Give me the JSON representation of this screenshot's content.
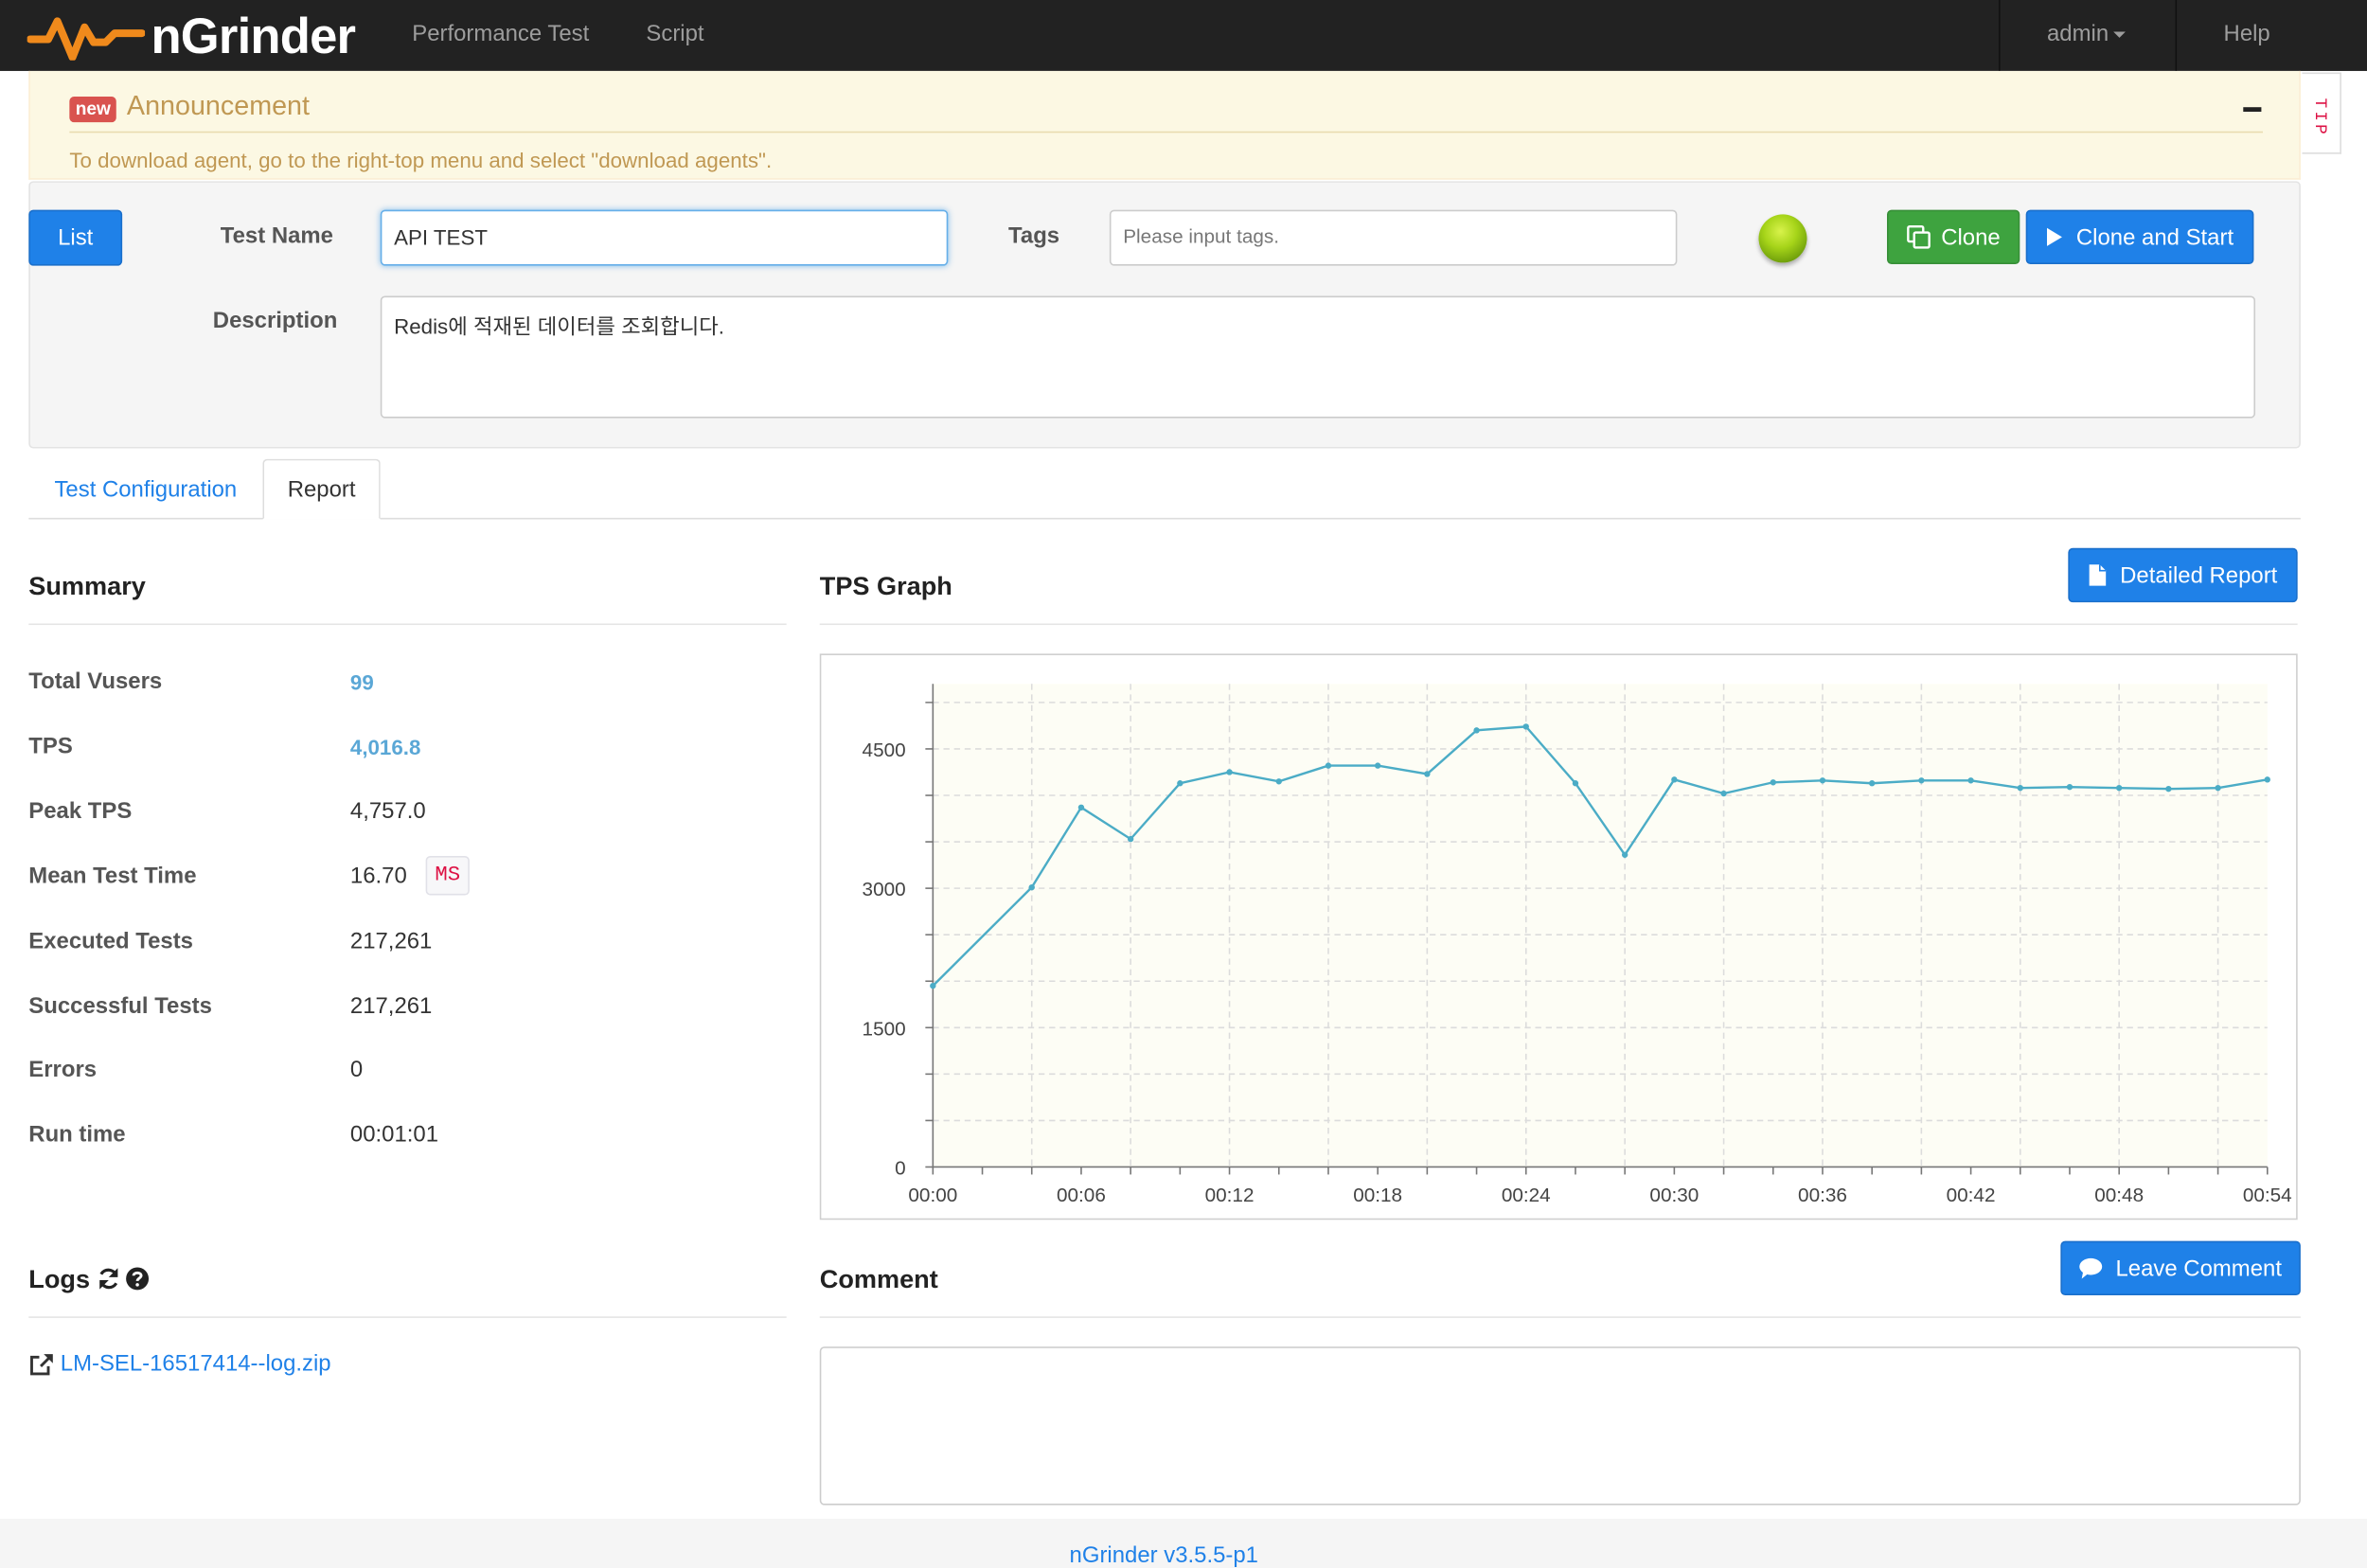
{
  "navbar": {
    "brand": "nGrinder",
    "links": [
      "Performance Test",
      "Script"
    ],
    "user": "admin",
    "help": "Help"
  },
  "announcement": {
    "badge": "new",
    "title": "Announcement",
    "body": "To download agent, go to the right-top menu and select \"download agents\"."
  },
  "tip": "TIP",
  "form": {
    "list_label": "List",
    "test_name_label": "Test Name",
    "test_name_value": "API TEST",
    "tags_label": "Tags",
    "tags_placeholder": "Please input tags.",
    "description_label": "Description",
    "description_value": "Redis에 적재된 데이터를 조회합니다.",
    "clone_label": "Clone",
    "clone_start_label": "Clone and Start",
    "status_color": "#a6d419"
  },
  "tabs": [
    {
      "label": "Test Configuration",
      "active": false
    },
    {
      "label": "Report",
      "active": true
    }
  ],
  "summary": {
    "title": "Summary",
    "rows": [
      {
        "key": "Total Vusers",
        "value": "99"
      },
      {
        "key": "TPS",
        "value": "4,016.8"
      },
      {
        "key": "Peak TPS",
        "value": "4,757.0"
      },
      {
        "key": "Mean Test Time",
        "value": "16.70"
      },
      {
        "key": "Executed Tests",
        "value": "217,261"
      },
      {
        "key": "Successful Tests",
        "value": "217,261"
      },
      {
        "key": "Errors",
        "value": "0"
      },
      {
        "key": "Run time",
        "value": "00:01:01"
      }
    ],
    "mean_unit": "MS"
  },
  "tps_graph": {
    "title": "TPS Graph",
    "detailed_report_label": "Detailed Report"
  },
  "chart_data": {
    "type": "line",
    "title": "",
    "xlabel": "",
    "ylabel": "",
    "x_ticks": [
      "00:00",
      "00:06",
      "00:12",
      "00:18",
      "00:24",
      "00:30",
      "00:36",
      "00:42",
      "00:48",
      "00:54"
    ],
    "y_ticks": [
      0,
      1500,
      3000,
      4500
    ],
    "ylim": [
      0,
      5200
    ],
    "x_seconds": [
      0,
      4,
      6,
      8,
      10,
      12,
      14,
      16,
      18,
      20,
      22,
      24,
      26,
      28,
      30,
      32,
      34,
      36,
      38,
      40,
      42,
      44,
      46,
      48,
      50,
      52,
      54
    ],
    "values": [
      1950,
      3010,
      3870,
      3530,
      4130,
      4250,
      4150,
      4320,
      4320,
      4230,
      4700,
      4740,
      4130,
      3360,
      4170,
      4020,
      4140,
      4160,
      4130,
      4160,
      4160,
      4080,
      4090,
      4080,
      4070,
      4080,
      4170
    ],
    "grid": true,
    "line_color": "#4bacc6",
    "plot_background": "#fdfdf5"
  },
  "logs": {
    "title": "Logs",
    "file": "LM-SEL-16517414--log.zip"
  },
  "comment": {
    "title": "Comment",
    "button_label": "Leave Comment"
  },
  "footer": "nGrinder v3.5.5-p1"
}
